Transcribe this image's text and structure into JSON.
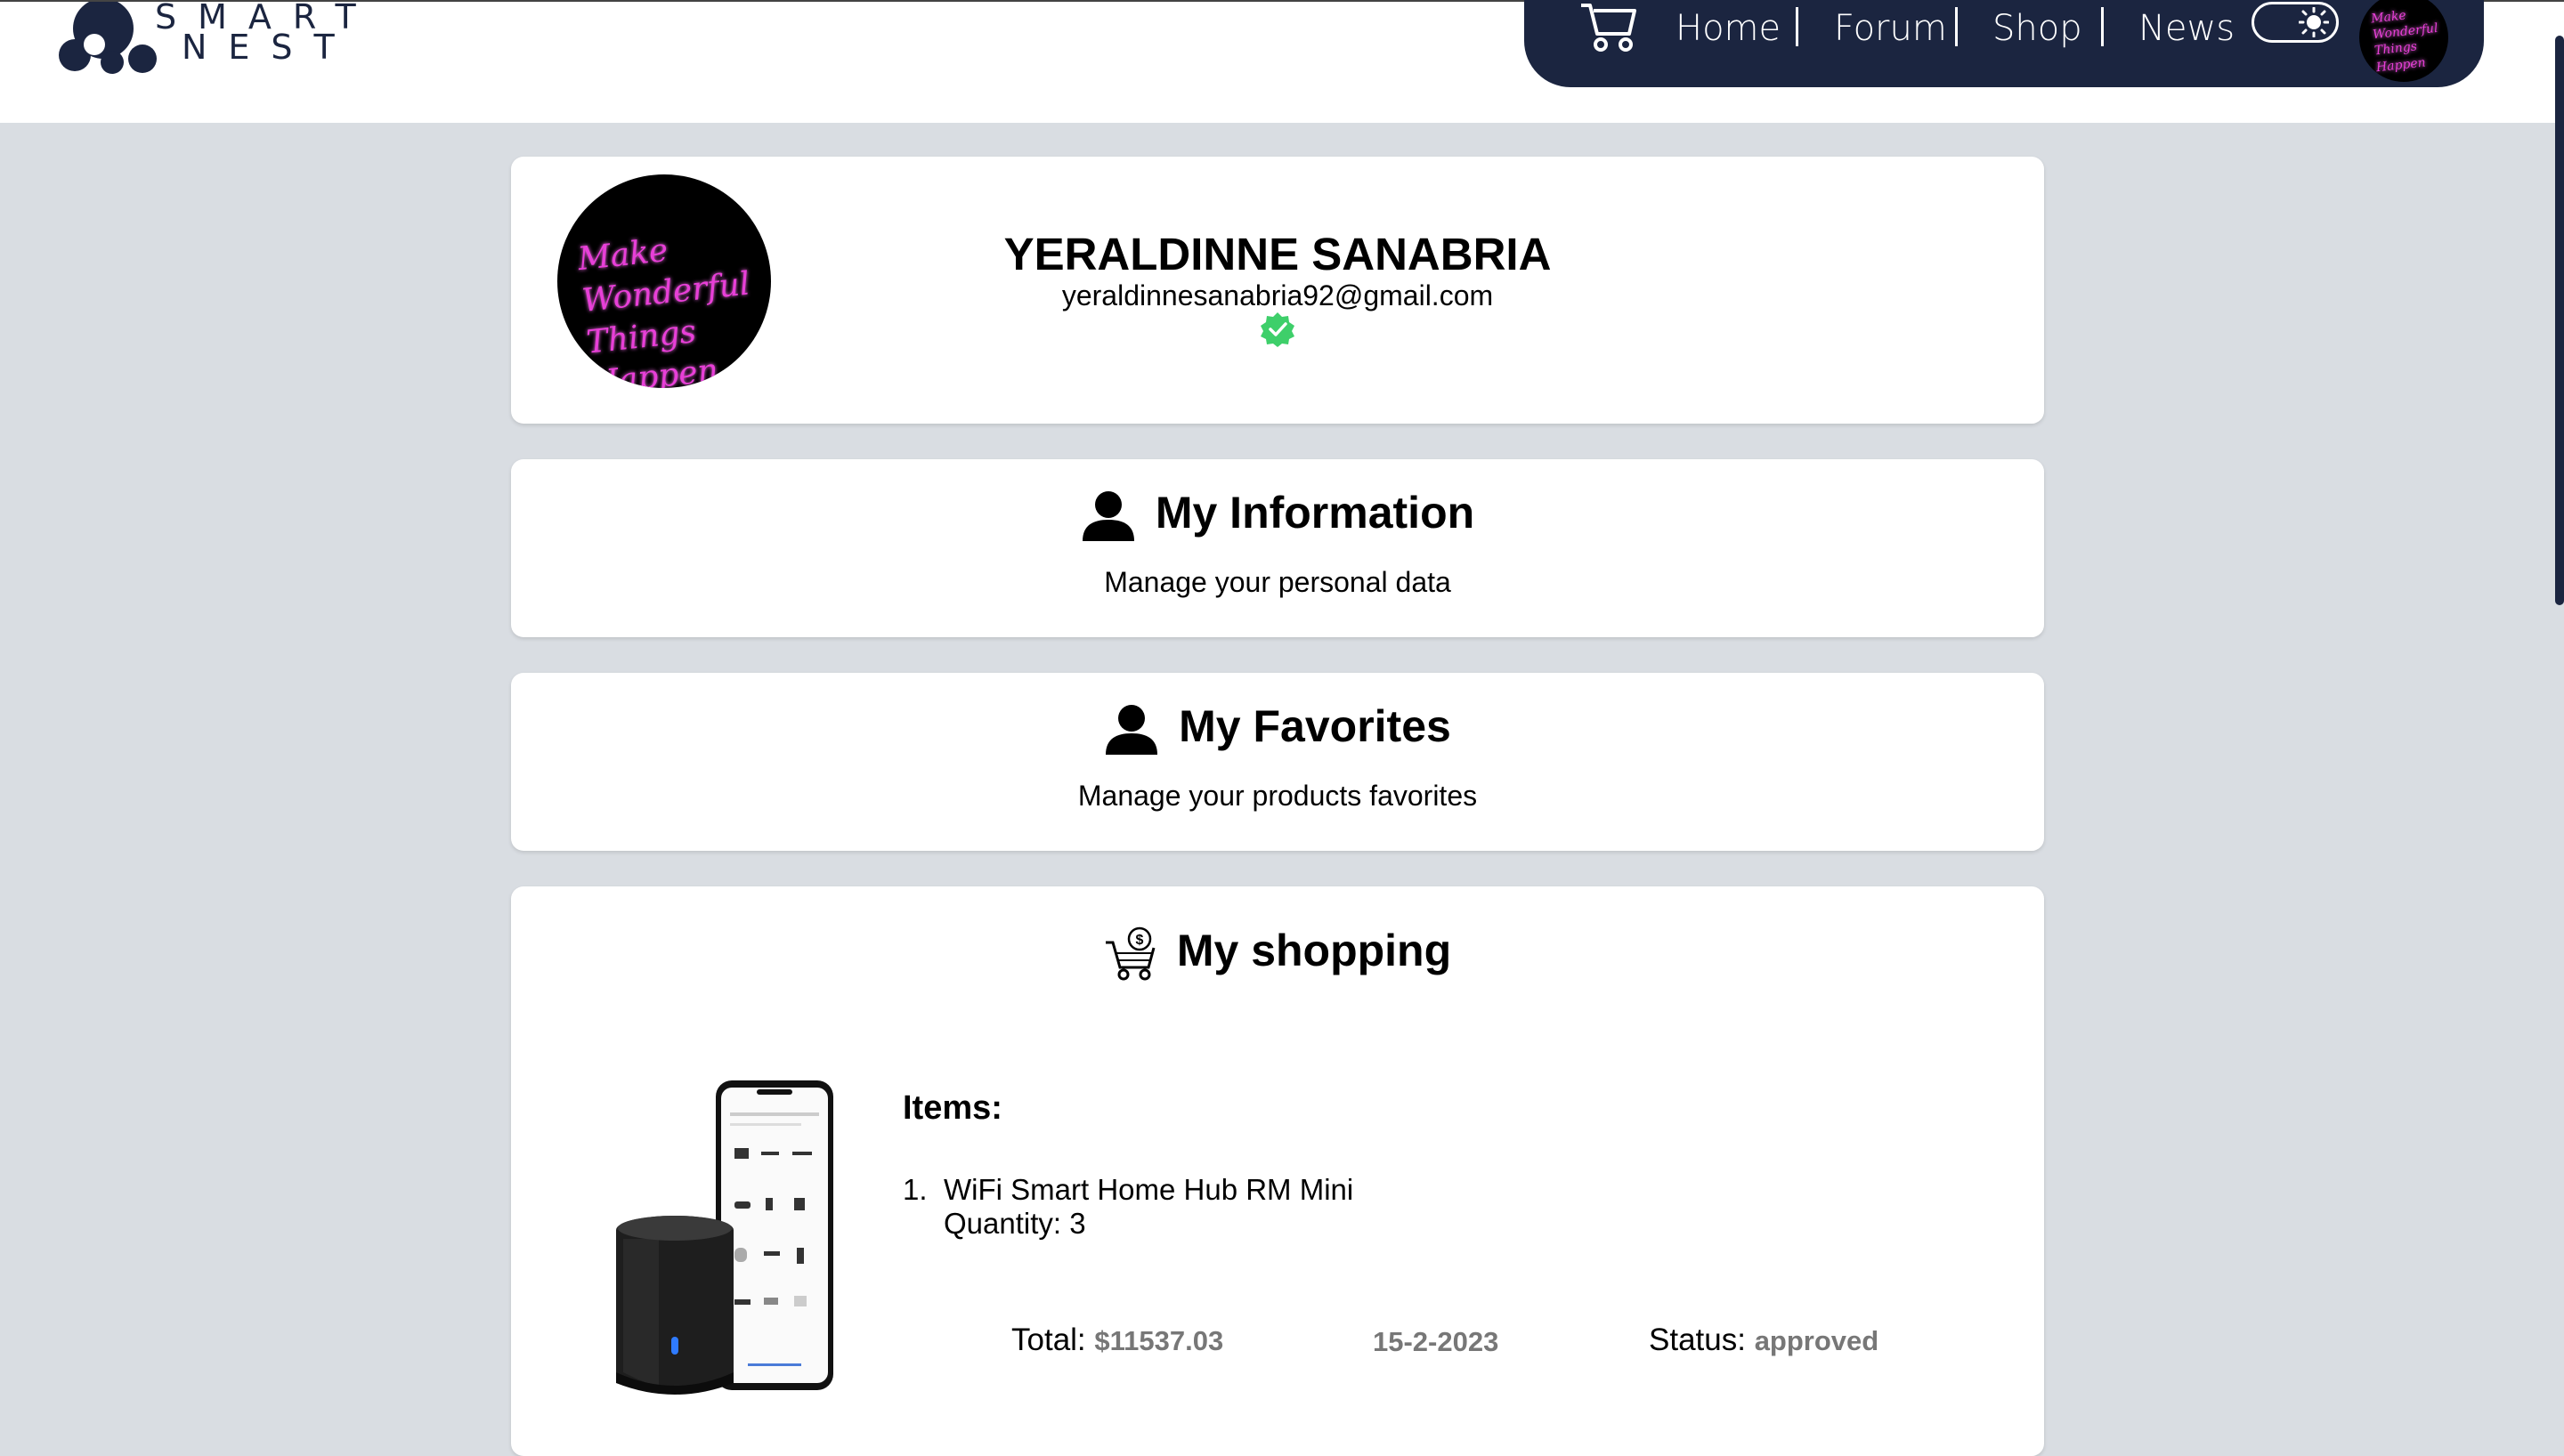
{
  "header": {
    "logo": {
      "line1": "SMART",
      "line2": "NEST"
    },
    "nav": {
      "home": "Home",
      "forum": "Forum",
      "shop": "Shop",
      "news": "News"
    },
    "avatar_text": {
      "line1": "Make Wonderful",
      "line2": "Things Happen"
    }
  },
  "profile": {
    "avatar_text": {
      "line1": "Make Wonderful",
      "line2": "Things Happen"
    },
    "name": "YERALDINNE SANABRIA",
    "email": "yeraldinnesanabria92@gmail.com"
  },
  "sections": {
    "information": {
      "title": "My Information",
      "subtitle": "Manage your personal data"
    },
    "favorites": {
      "title": "My Favorites",
      "subtitle": "Manage your products favorites"
    }
  },
  "shopping": {
    "title": "My shopping",
    "items_label": "Items:",
    "items": [
      {
        "number": "1.",
        "name": "WiFi Smart Home Hub RM Mini",
        "quantity_label": "Quantity: 3"
      }
    ],
    "total_label": "Total:",
    "total_value": "$11537.03",
    "date": "15-2-2023",
    "status_label": "Status:",
    "status_value": "approved"
  },
  "colors": {
    "navy": "#1b2540",
    "background": "#d9dde2",
    "verified": "#3ecf6a",
    "neon": "#e83fd8",
    "muted": "#777777"
  }
}
